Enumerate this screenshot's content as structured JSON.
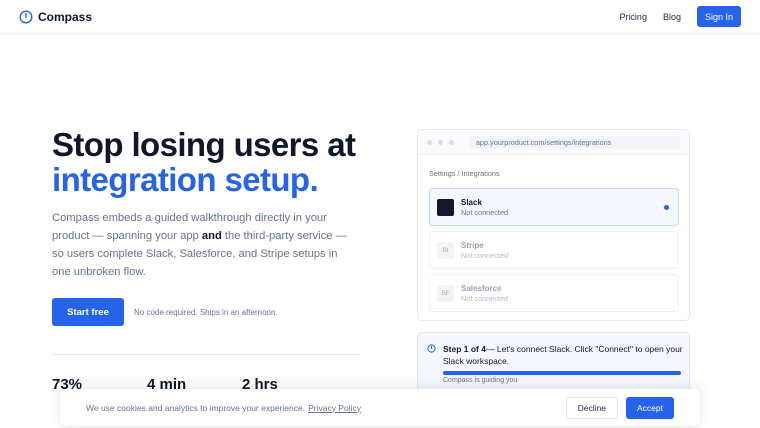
{
  "nav": {
    "brand": "Compass",
    "links": [
      "Pricing",
      "Blog"
    ],
    "signin_label": "Sign In"
  },
  "hero": {
    "title_line1": "Stop losing users at",
    "title_line2": "integration setup.",
    "desc_before": "Compass embeds a guided walkthrough directly in your product — spanning your app ",
    "desc_bold": "and",
    "desc_after": " the third-party service — so users complete Slack, Salesforce, and Stripe setups in one unbroken flow.",
    "cta_label": "Start free",
    "cta_note": "No code required. Ships in an afternoon.",
    "stats": [
      "73%",
      "4 min",
      "2 hrs"
    ]
  },
  "mock": {
    "url": "app.yourproduct.com/settings/integrations",
    "breadcrumb": "Settings / Integrations",
    "integrations": [
      {
        "name": "Slack",
        "status": "Not connected",
        "abbr": "",
        "active": true
      },
      {
        "name": "Stripe",
        "status": "Not connected",
        "abbr": "St",
        "active": false
      },
      {
        "name": "Salesforce",
        "status": "Not connected",
        "abbr": "SF",
        "active": false
      }
    ]
  },
  "guide": {
    "step": "Step 1 of 4",
    "message": "— Let's connect Slack. Click \"Connect\" to open your Slack workspace.",
    "progress": 1.0,
    "footer": "Compass is guiding you"
  },
  "cookie": {
    "text": "We use cookies and analytics to improve your experience.",
    "link": "Privacy Policy",
    "decline_label": "Decline",
    "accept_label": "Accept"
  },
  "colors": {
    "accent": "#2563eb",
    "text": "#0f172a",
    "muted": "#64748b"
  }
}
